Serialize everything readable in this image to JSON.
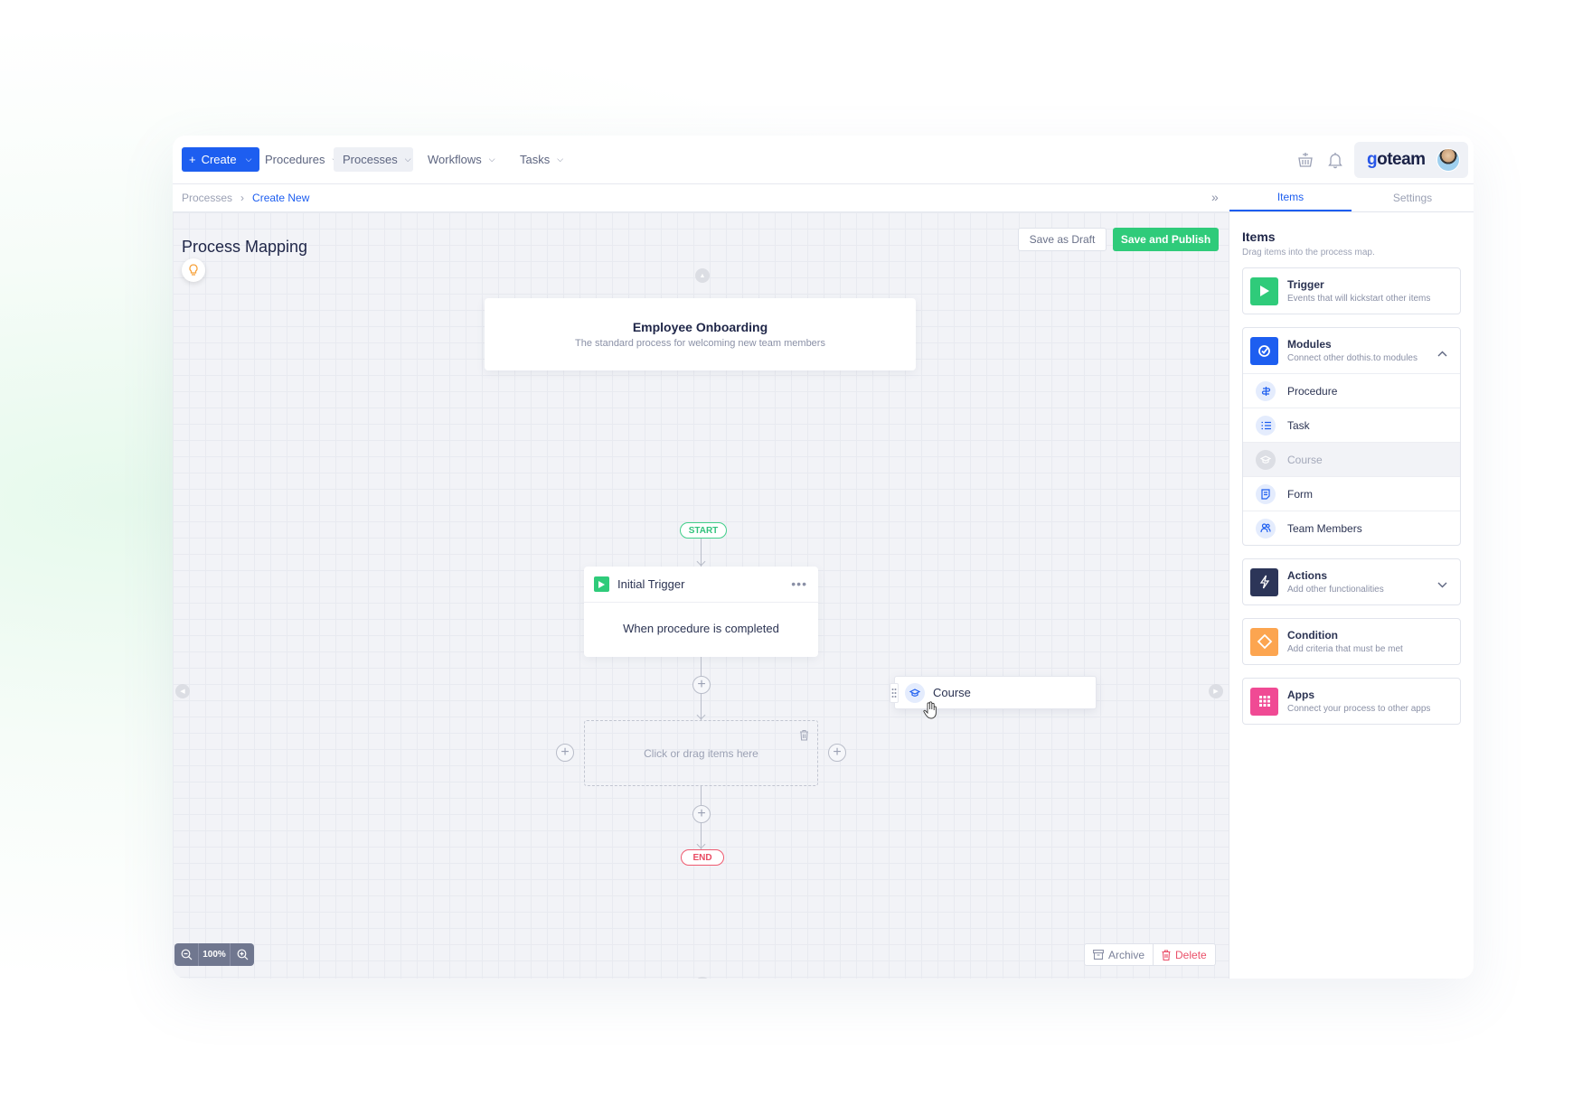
{
  "header": {
    "create_label": "Create",
    "nav": [
      {
        "label": "Procedures",
        "active": false
      },
      {
        "label": "Processes",
        "active": true
      },
      {
        "label": "Workflows",
        "active": false
      },
      {
        "label": "Tasks",
        "active": false
      }
    ],
    "brand": "goteam",
    "icons": [
      "basket-icon",
      "bell-icon",
      "avatar"
    ]
  },
  "breadcrumb": {
    "items": [
      "Processes",
      "Create New"
    ]
  },
  "canvas": {
    "title": "Process Mapping",
    "save_draft_label": "Save as Draft",
    "save_publish_label": "Save and Publish",
    "process_card": {
      "title": "Employee Onboarding",
      "subtitle": "The standard process for welcoming new team members"
    },
    "start_label": "START",
    "end_label": "END",
    "trigger_card": {
      "title": "Initial Trigger",
      "body": "When procedure is completed"
    },
    "dropzone_label": "Click or drag items here",
    "dragged_item": "Course",
    "zoom_value": "100%",
    "archive_label": "Archive",
    "delete_label": "Delete"
  },
  "right_panel": {
    "tabs": [
      {
        "label": "Items",
        "active": true
      },
      {
        "label": "Settings",
        "active": false
      }
    ],
    "title": "Items",
    "subtitle": "Drag items into the process map.",
    "items": {
      "trigger": {
        "name": "Trigger",
        "desc": "Events that will kickstart other items",
        "color": "#2fcb7a"
      },
      "modules": {
        "name": "Modules",
        "desc": "Connect other dothis.to modules",
        "color": "#1d5ef0",
        "expanded": true,
        "children": [
          {
            "label": "Procedure",
            "disabled": false
          },
          {
            "label": "Task",
            "disabled": false
          },
          {
            "label": "Course",
            "disabled": true
          },
          {
            "label": "Form",
            "disabled": false
          },
          {
            "label": "Team Members",
            "disabled": false
          }
        ]
      },
      "actions": {
        "name": "Actions",
        "desc": "Add other functionalities",
        "color": "#2c3558",
        "expanded": false
      },
      "condition": {
        "name": "Condition",
        "desc": "Add criteria that must be met",
        "color": "#fca550"
      },
      "apps": {
        "name": "Apps",
        "desc": "Connect your process to other apps",
        "color": "#f04a94"
      }
    }
  }
}
